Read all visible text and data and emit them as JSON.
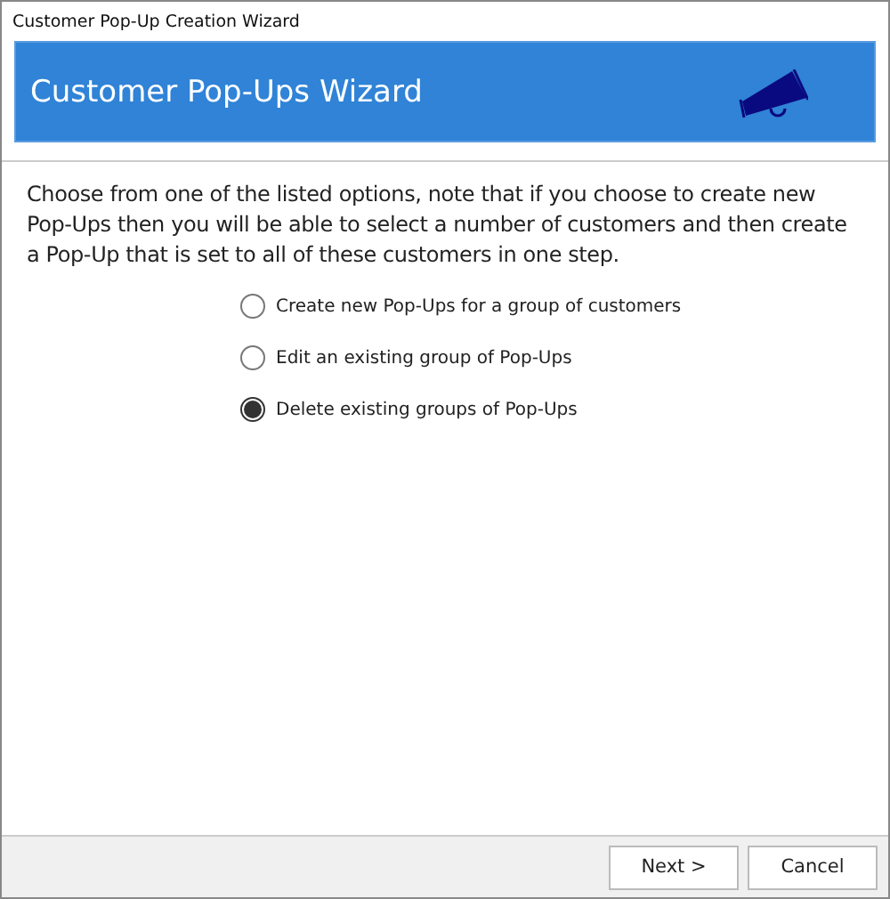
{
  "window": {
    "title": "Customer Pop-Up Creation Wizard"
  },
  "banner": {
    "title": "Customer Pop-Ups Wizard"
  },
  "description": "Choose from one of the listed options, note that if you choose to create new Pop-Ups then you will be able to select a number of customers and then create a Pop-Up that is set to all of these customers in one step.",
  "options": [
    {
      "label": "Create new Pop-Ups for a group of customers",
      "selected": false
    },
    {
      "label": "Edit an existing group of Pop-Ups",
      "selected": false
    },
    {
      "label": "Delete existing groups of Pop-Ups",
      "selected": true
    }
  ],
  "buttons": [
    "Next >",
    "Cancel"
  ]
}
